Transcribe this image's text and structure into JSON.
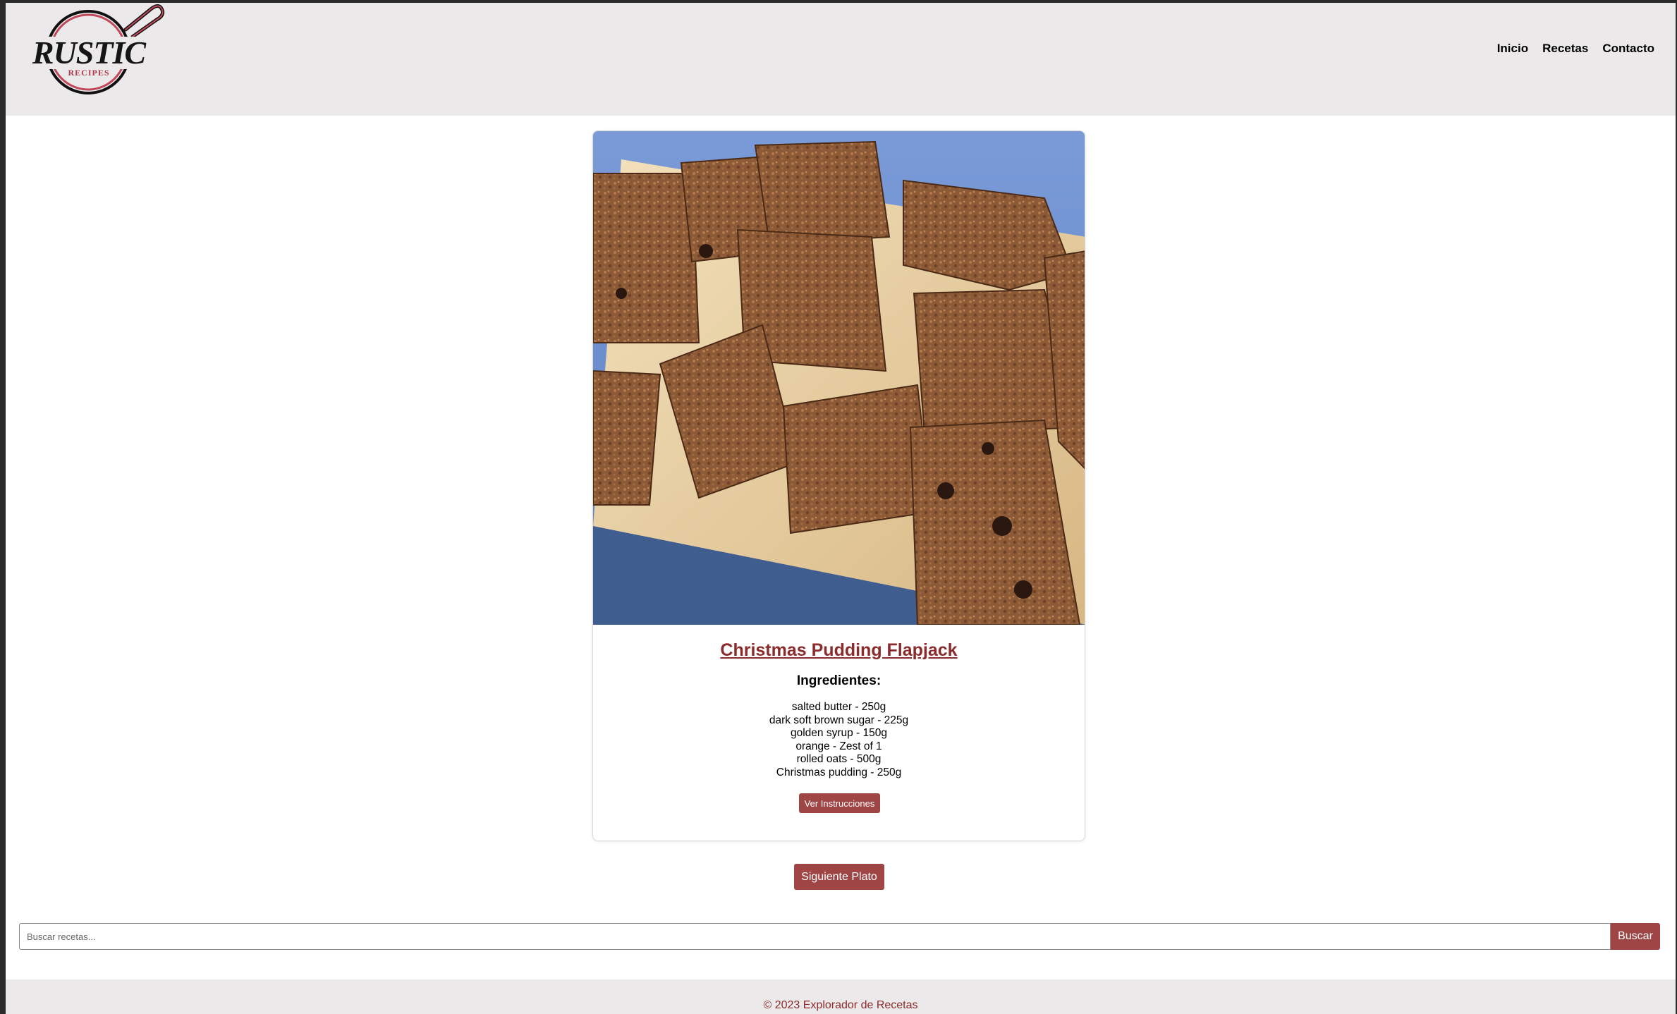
{
  "header": {
    "logo": {
      "main_text": "RUSTIC",
      "sub_text": "RECIPES"
    },
    "nav": [
      {
        "label": "Inicio"
      },
      {
        "label": "Recetas"
      },
      {
        "label": "Contacto"
      }
    ]
  },
  "recipe": {
    "title": "Christmas Pudding Flapjack",
    "ingredients_heading": "Ingredientes:",
    "ingredients": [
      "salted butter - 250g",
      "dark soft brown sugar - 225g",
      "golden syrup - 150g",
      "orange - Zest of 1",
      "rolled oats - 500g",
      "Christmas pudding - 250g"
    ],
    "instructions_button": "Ver Instrucciones"
  },
  "next_button": "Siguiente Plato",
  "search": {
    "placeholder": "Buscar recetas...",
    "value": "",
    "button": "Buscar"
  },
  "footer": {
    "text": "© 2023 Explorador de Recetas"
  },
  "colors": {
    "accent": "#a04545",
    "title": "#8b2b2b",
    "header_bg": "#ebe9ea"
  }
}
